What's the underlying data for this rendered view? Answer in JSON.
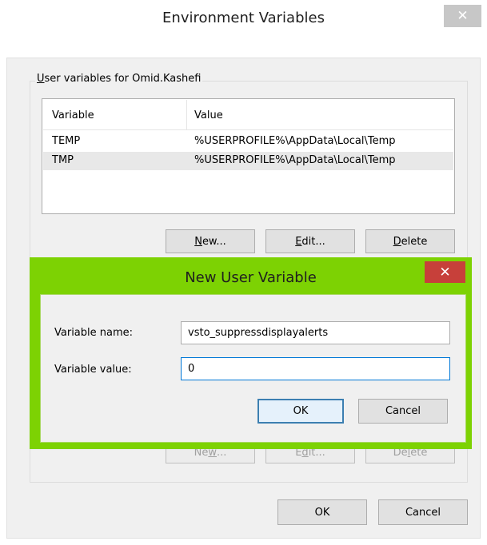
{
  "outer": {
    "title": "Environment Variables",
    "close_glyph": "✕",
    "user_group": {
      "legend_prefix": "",
      "legend_access": "U",
      "legend_rest": "ser variables for Omid.Kashefi",
      "columns": [
        "Variable",
        "Value"
      ],
      "rows": [
        {
          "variable": "TEMP",
          "value": "%USERPROFILE%\\AppData\\Local\\Temp"
        },
        {
          "variable": "TMP",
          "value": "%USERPROFILE%\\AppData\\Local\\Temp"
        }
      ],
      "buttons": {
        "new": {
          "access": "N",
          "rest": "ew..."
        },
        "edit": {
          "access": "E",
          "rest": "dit..."
        },
        "delete": {
          "access": "D",
          "rest": "elete"
        }
      }
    },
    "system_group": {
      "buttons": {
        "new": {
          "pre": "Ne",
          "access": "w",
          "rest": "..."
        },
        "edit": {
          "pre": "E",
          "access": "d",
          "rest": "it..."
        },
        "delete": {
          "pre": "De",
          "access": "l",
          "rest": "ete"
        }
      }
    },
    "ok_label": "OK",
    "cancel_label": "Cancel"
  },
  "inner": {
    "title": "New User Variable",
    "close_glyph": "✕",
    "name_label": "Variable name:",
    "value_label": "Variable value:",
    "name_value": "vsto_suppressdisplayalerts",
    "value_value": "0",
    "ok_label": "OK",
    "cancel_label": "Cancel"
  },
  "colors": {
    "inner_frame": "#7dd203",
    "inner_close": "#c7403a",
    "outer_close": "#c7c7c7",
    "focus_border": "#0078d7"
  }
}
